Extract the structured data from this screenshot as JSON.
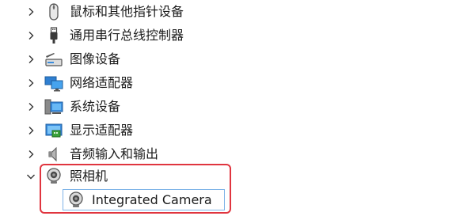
{
  "tree": {
    "items": [
      {
        "label": "鼠标和其他指针设备",
        "icon": "mouse-icon",
        "expanded": false
      },
      {
        "label": "通用串行总线控制器",
        "icon": "usb-icon",
        "expanded": false
      },
      {
        "label": "图像设备",
        "icon": "scanner-icon",
        "expanded": false
      },
      {
        "label": "网络适配器",
        "icon": "network-adapter-icon",
        "expanded": false
      },
      {
        "label": "系统设备",
        "icon": "system-device-icon",
        "expanded": false
      },
      {
        "label": "显示适配器",
        "icon": "display-adapter-icon",
        "expanded": false
      },
      {
        "label": "音频输入和输出",
        "icon": "speaker-icon",
        "expanded": false
      },
      {
        "label": "照相机",
        "icon": "camera-icon",
        "expanded": true,
        "children": [
          {
            "label": "Integrated Camera",
            "icon": "webcam-icon",
            "selected": true
          }
        ]
      }
    ]
  },
  "highlight_color": "#e0353f",
  "selection_border_color": "#7fb4e8"
}
